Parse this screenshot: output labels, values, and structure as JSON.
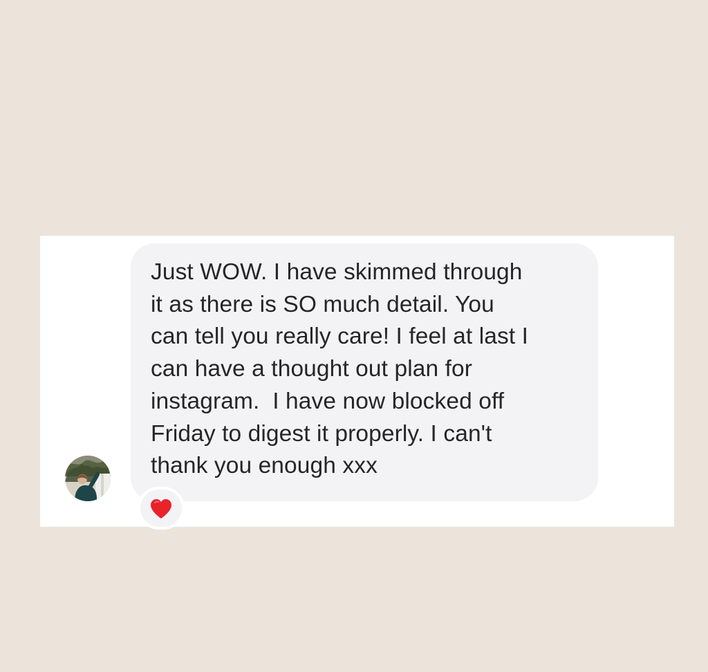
{
  "message": {
    "lines": [
      "Just WOW. I have skimmed through",
      "it as there is SO much detail. You",
      "can tell you really care! I feel at last I",
      "can have a thought out plan for",
      "instagram.  I have now blocked off",
      "Friday to digest it properly. I can't",
      "thank you enough xxx"
    ]
  },
  "reaction": {
    "icon": "red-heart-icon",
    "color": "#e8232a"
  },
  "avatar": {
    "icon": "profile-photo"
  },
  "colors": {
    "page_background": "#ece3db",
    "card_background": "#ffffff",
    "bubble_background": "#f3f3f5",
    "text": "#262626"
  }
}
